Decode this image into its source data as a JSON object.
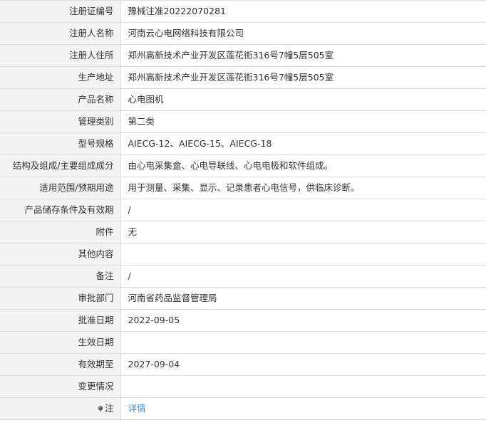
{
  "rows": [
    {
      "label": "注册证编号",
      "value": "豫械注准20222070281"
    },
    {
      "label": "注册人名称",
      "value": "河南云心电网络科技有限公司"
    },
    {
      "label": "注册人住所",
      "value": "郑州高新技术产业开发区莲花街316号7幢5层505室"
    },
    {
      "label": "生产地址",
      "value": "郑州高新技术产业开发区莲花街316号7幢5层505室"
    },
    {
      "label": "产品名称",
      "value": "心电图机"
    },
    {
      "label": "管理类别",
      "value": "第二类"
    },
    {
      "label": "型号规格",
      "value": "AIECG-12、AIECG-15、AIECG-18"
    },
    {
      "label": "结构及组成/主要组成成分",
      "value": "由心电采集盒、心电导联线、心电电极和软件组成。"
    },
    {
      "label": "适用范围/预期用途",
      "value": "用于测量、采集、显示、记录患者心电信号，供临床诊断。"
    },
    {
      "label": "产品储存条件及有效期",
      "value": "/"
    },
    {
      "label": "附件",
      "value": "无"
    },
    {
      "label": "其他内容",
      "value": ""
    },
    {
      "label": "备注",
      "value": "/"
    },
    {
      "label": "审批部门",
      "value": "河南省药品监督管理局"
    },
    {
      "label": "批准日期",
      "value": "2022-09-05"
    },
    {
      "label": "生效日期",
      "value": ""
    },
    {
      "label": "有效期至",
      "value": "2027-09-04"
    },
    {
      "label": "变更情况",
      "value": ""
    }
  ],
  "note": {
    "label": "注",
    "icon": "pin-icon",
    "link_text": "详情",
    "link_color": "#3c8fd4"
  },
  "colors": {
    "label_background": "#f3f3f3",
    "border": "#dcdcdc",
    "text": "#333333"
  }
}
